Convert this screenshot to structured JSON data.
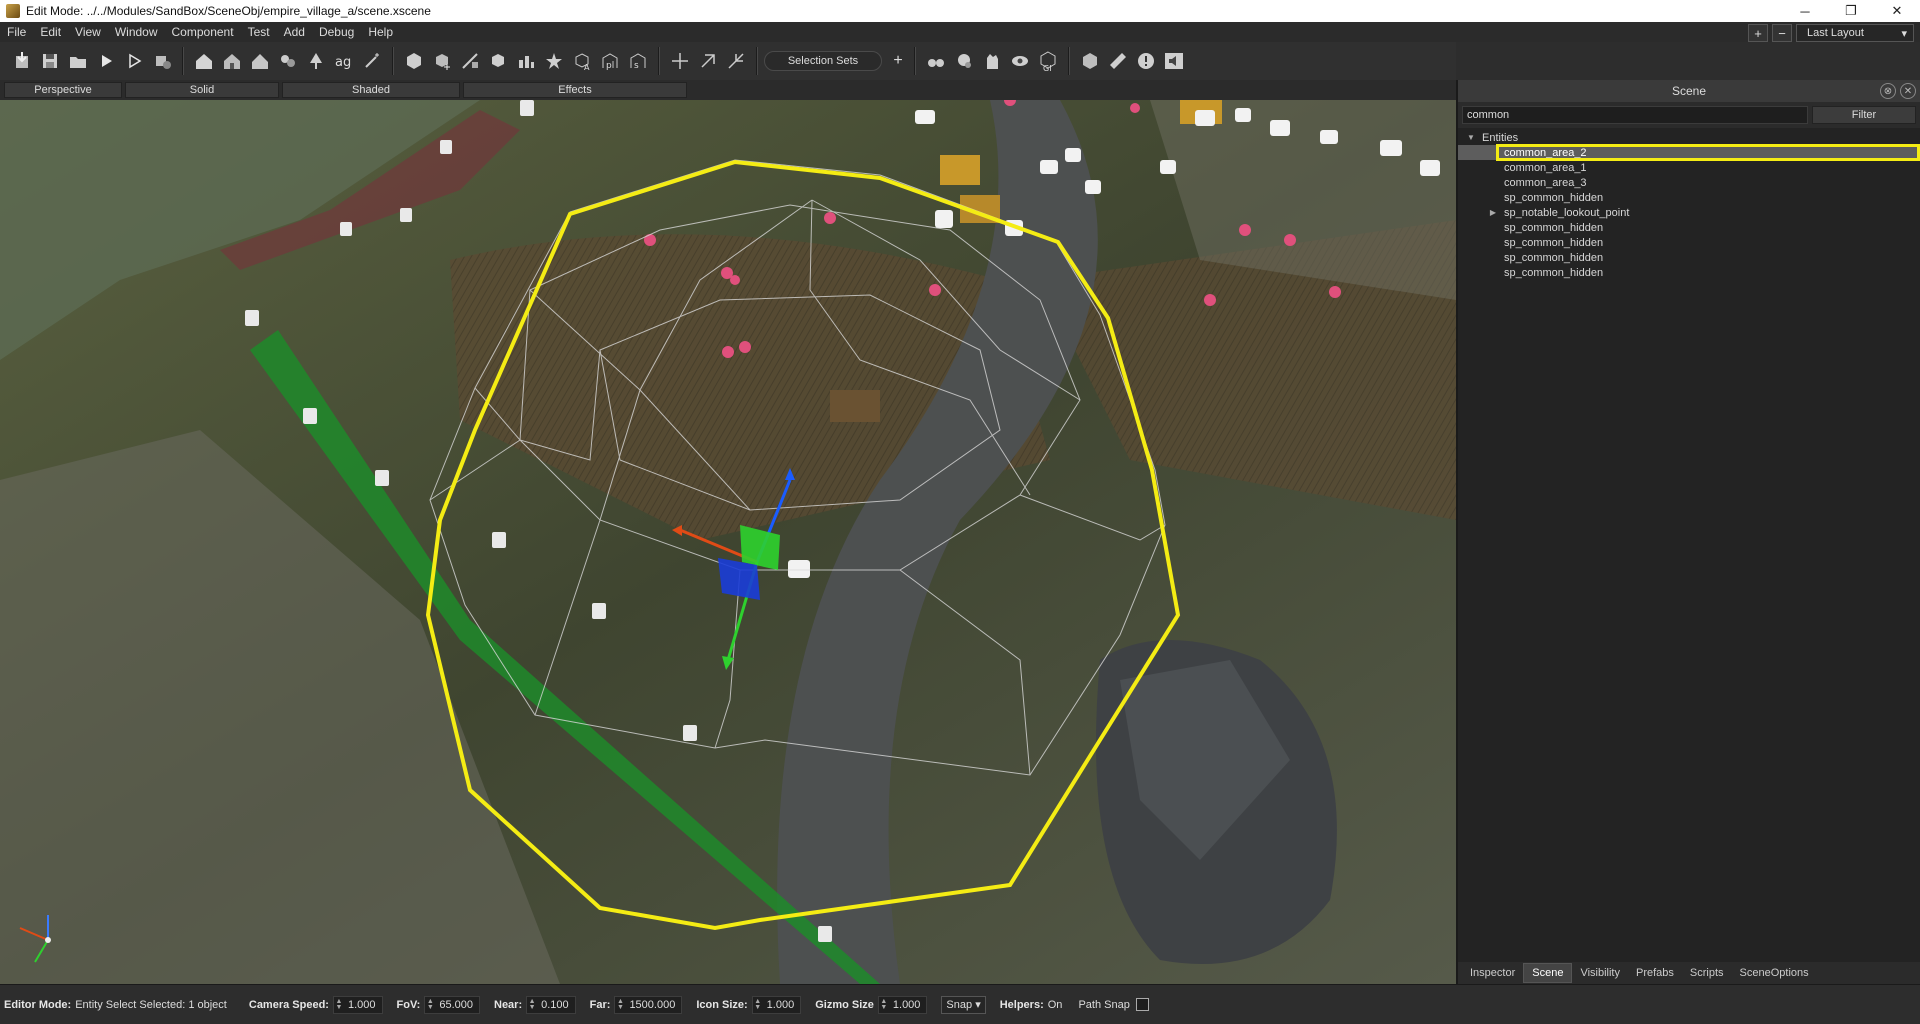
{
  "window": {
    "title": "Edit Mode: ../../Modules/SandBox/SceneObj/empire_village_a/scene.xscene",
    "minimize": "─",
    "restore": "❐",
    "close": "✕"
  },
  "menu": [
    "File",
    "Edit",
    "View",
    "Window",
    "Component",
    "Test",
    "Add",
    "Debug",
    "Help"
  ],
  "layout": {
    "add": "+",
    "remove": "−",
    "selected": "Last Layout",
    "caret": "▾"
  },
  "toolbar": {
    "selection_sets": "Selection Sets",
    "add_selection_set": "+",
    "icons": [
      "import-icon",
      "save-icon",
      "open-folder-icon",
      "play-icon",
      "play-outline-icon",
      "settings-play-icon",
      "house-icon",
      "house2-icon",
      "house3-icon",
      "decal-icon",
      "tree-icon",
      "ag-icon",
      "wand-icon",
      "cube-icon",
      "cube-plus-icon",
      "cube-edit-icon",
      "cube-entity-icon",
      "cube-mesh-icon",
      "cube-star-icon",
      "cube-a-icon",
      "cube-p-icon",
      "cube-s-icon",
      "move-icon",
      "rotate-icon",
      "scale-icon",
      "binoculars-icon",
      "weather-icon",
      "glove-icon",
      "eye-icon",
      "gi-icon",
      "render-icon",
      "measure-icon",
      "warning-icon",
      "audio-icon"
    ]
  },
  "view_bar": {
    "perspective": "Perspective",
    "solid": "Solid",
    "shaded": "Shaded",
    "effects": "Effects"
  },
  "scene_panel": {
    "title": "Scene",
    "search_value": "common",
    "filter_label": "Filter",
    "root_label": "Entities",
    "items": [
      {
        "label": "common_area_2",
        "selected": true
      },
      {
        "label": "common_area_1",
        "selected": false
      },
      {
        "label": "common_area_3",
        "selected": false
      },
      {
        "label": "sp_common_hidden",
        "selected": false
      },
      {
        "label": "sp_notable_lookout_point",
        "selected": false,
        "expandable": true
      },
      {
        "label": "sp_common_hidden",
        "selected": false
      },
      {
        "label": "sp_common_hidden",
        "selected": false
      },
      {
        "label": "sp_common_hidden",
        "selected": false
      },
      {
        "label": "sp_common_hidden",
        "selected": false
      }
    ],
    "tabs": [
      "Inspector",
      "Scene",
      "Visibility",
      "Prefabs",
      "Scripts",
      "SceneOptions"
    ],
    "active_tab": "Scene"
  },
  "status": {
    "editor_mode_label": "Editor Mode:",
    "editor_mode_value": "Entity Select  Selected: 1 object",
    "camera_speed_label": "Camera Speed:",
    "camera_speed": "1.000",
    "fov_label": "FoV:",
    "fov": "65.000",
    "near_label": "Near:",
    "near": "0.100",
    "far_label": "Far:",
    "far": "1500.000",
    "icon_size_label": "Icon Size:",
    "icon_size": "1.000",
    "gizmo_size_label": "Gizmo Size",
    "gizmo_size": "1.000",
    "snap_label": "Snap",
    "snap_caret": "▾",
    "helpers_label": "Helpers:",
    "helpers_value": "On",
    "path_snap_label": "Path Snap"
  },
  "colors": {
    "highlight": "#f4ec14",
    "terrain": "#4a4f36",
    "green_path": "#1f8a2a",
    "gizmo_x": "#e04b16",
    "gizmo_y": "#2ed12e",
    "gizmo_z": "#1a5cff"
  }
}
